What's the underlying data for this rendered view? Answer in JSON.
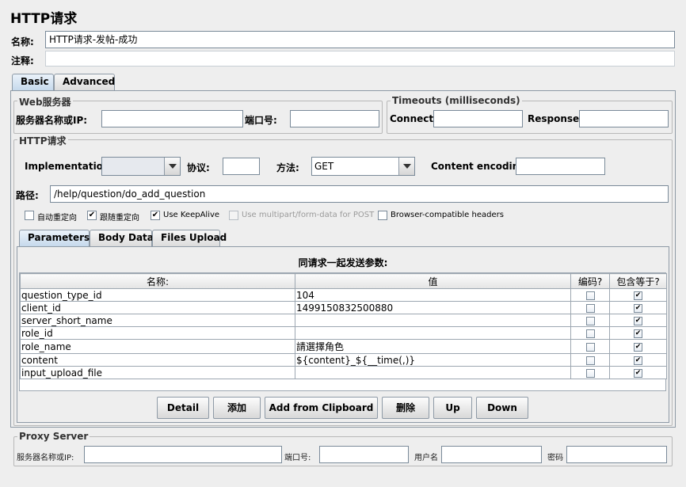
{
  "title": "HTTP请求",
  "name_label": "名称:",
  "name_value": "HTTP请求-发帖-成功",
  "comment_label": "注释:",
  "comment_value": "",
  "tabs": [
    {
      "label": "Basic"
    },
    {
      "label": "Advanced"
    }
  ],
  "web_server": {
    "legend": "Web服务器",
    "server_label": "服务器名称或IP:",
    "server_value": "",
    "port_label": "端口号:",
    "port_value": ""
  },
  "timeouts": {
    "legend": "Timeouts (milliseconds)",
    "connect_label": "Connect:",
    "connect_value": "",
    "response_label": "Response:",
    "response_value": ""
  },
  "http_request": {
    "legend": "HTTP请求",
    "implementation_label": "Implementation:",
    "implementation_value": "",
    "protocol_label": "协议:",
    "protocol_value": "",
    "method_label": "方法:",
    "method_value": "GET",
    "encoding_label": "Content encoding:",
    "encoding_value": "",
    "path_label": "路径:",
    "path_value": "/help/question/do_add_question"
  },
  "options": [
    {
      "label": "自动重定向",
      "checked": false,
      "enabled": true
    },
    {
      "label": "跟随重定向",
      "checked": true,
      "enabled": true
    },
    {
      "label": "Use KeepAlive",
      "checked": true,
      "enabled": true
    },
    {
      "label": "Use multipart/form-data for POST",
      "checked": false,
      "enabled": false
    },
    {
      "label": "Browser-compatible headers",
      "checked": false,
      "enabled": true
    }
  ],
  "sub_tabs": [
    {
      "label": "Parameters"
    },
    {
      "label": "Body Data"
    },
    {
      "label": "Files Upload"
    }
  ],
  "params": {
    "caption": "同请求一起发送参数:",
    "columns": [
      "名称:",
      "值",
      "编码?",
      "包含等于?"
    ],
    "rows": [
      {
        "name": "question_type_id",
        "value": "104",
        "encode": false,
        "include_equals": true
      },
      {
        "name": "client_id",
        "value": "1499150832500880",
        "encode": false,
        "include_equals": true
      },
      {
        "name": "server_short_name",
        "value": "",
        "encode": false,
        "include_equals": true
      },
      {
        "name": "role_id",
        "value": "",
        "encode": false,
        "include_equals": true
      },
      {
        "name": "role_name",
        "value": "請選擇角色",
        "encode": false,
        "include_equals": true
      },
      {
        "name": "content",
        "value": "${content}_${__time(,)}",
        "encode": false,
        "include_equals": true
      },
      {
        "name": "input_upload_file",
        "value": "",
        "encode": false,
        "include_equals": true
      }
    ]
  },
  "buttons": {
    "detail": "Detail",
    "add": "添加",
    "add_clipboard": "Add from Clipboard",
    "delete": "删除",
    "up": "Up",
    "down": "Down"
  },
  "proxy": {
    "legend": "Proxy Server",
    "server_label": "服务器名称或IP:",
    "server_value": "",
    "port_label": "端口号:",
    "port_value": "",
    "user_label": "用户名",
    "user_value": "",
    "password_label": "密码",
    "password_value": ""
  },
  "check_mark": "✔"
}
